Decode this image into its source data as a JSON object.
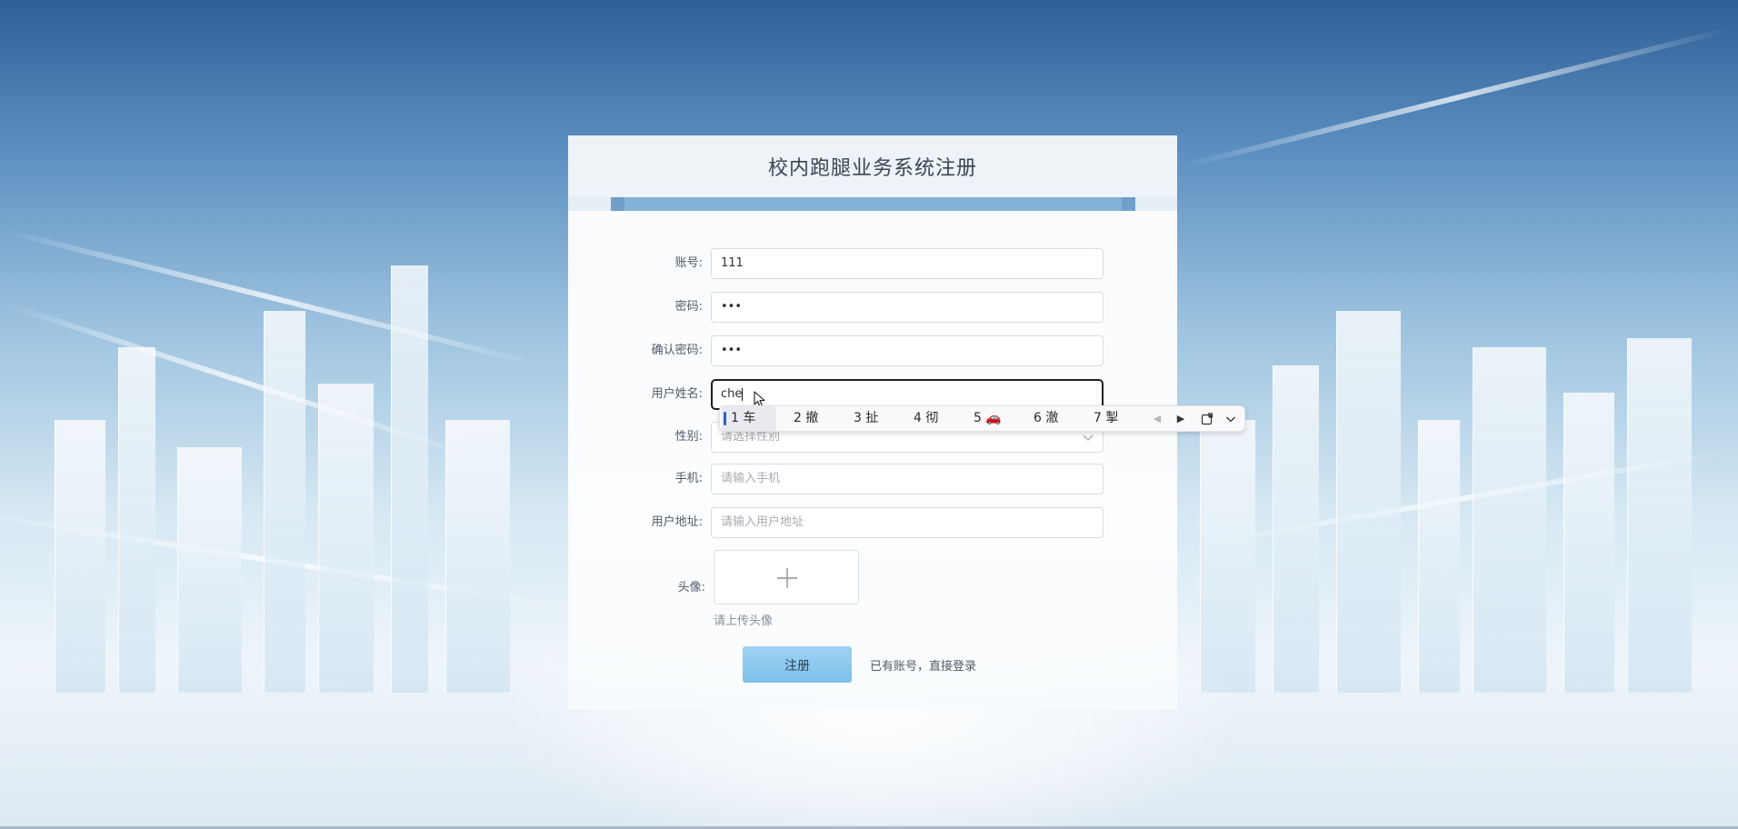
{
  "page": {
    "title": "校内跑腿业务系统注册"
  },
  "form": {
    "account": {
      "label": "账号:",
      "value": "111"
    },
    "password": {
      "label": "密码:",
      "value": "•••"
    },
    "confirm_password": {
      "label": "确认密码:",
      "value": "•••"
    },
    "username": {
      "label": "用户姓名:",
      "value": "che"
    },
    "gender": {
      "label": "性别:",
      "placeholder": "请选择性别"
    },
    "phone": {
      "label": "手机:",
      "placeholder": "请输入手机"
    },
    "address": {
      "label": "用户地址:",
      "placeholder": "请输入用户地址"
    },
    "avatar": {
      "label": "头像:",
      "hint": "请上传头像"
    },
    "register_label": "注册",
    "login_link": "已有账号，直接登录"
  },
  "ime": {
    "candidates": [
      "1 车",
      "2 撤",
      "3 扯",
      "4 彻",
      "5 🚗",
      "6 澈",
      "7 掣"
    ]
  },
  "colors": {
    "accent_button": "#8ccaf0",
    "title_text": "#3a4654",
    "ime_selection": "#2a62c9"
  },
  "icons": [
    "select-arrow-icon",
    "plus-icon",
    "prev-page-icon",
    "next-page-icon",
    "emoji-sticker-icon",
    "expand-candidates-icon",
    "mouse-cursor-icon"
  ]
}
